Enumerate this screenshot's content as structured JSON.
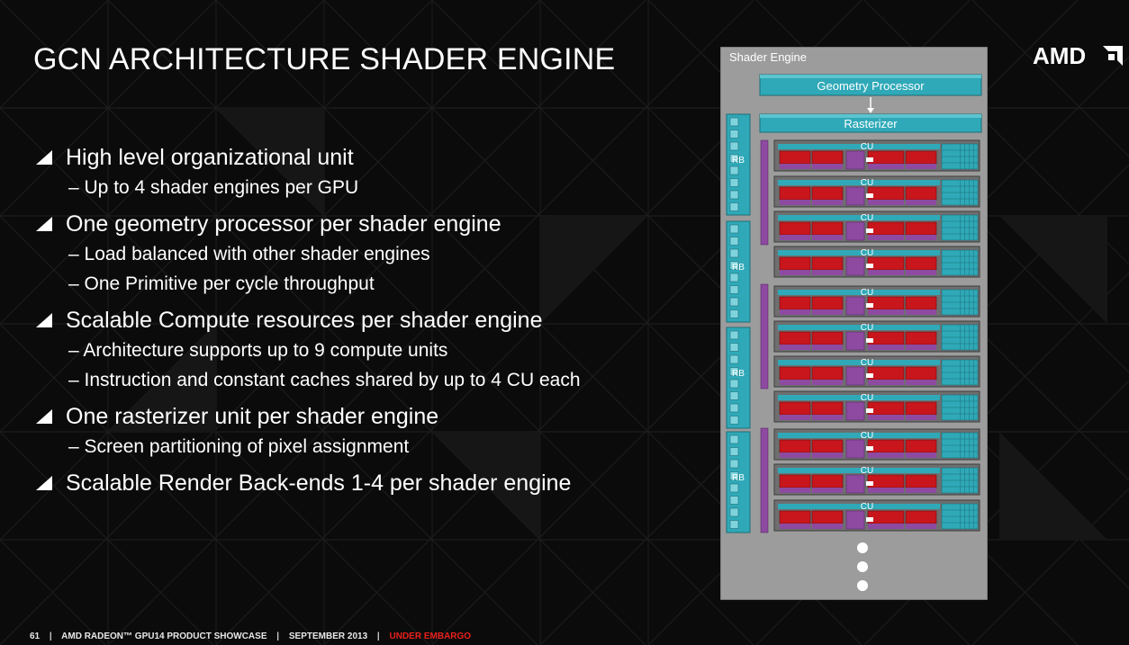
{
  "slide": {
    "title": "GCN ARCHITECTURE SHADER ENGINE",
    "logo_text": "AMD",
    "bullets": [
      {
        "text": "High level organizational unit",
        "subs": [
          "– Up to 4 shader engines per GPU"
        ]
      },
      {
        "text": "One geometry processor per shader engine",
        "subs": [
          "– Load balanced with other shader engines",
          "– One Primitive per cycle throughput"
        ]
      },
      {
        "text": "Scalable Compute resources per shader engine",
        "subs": [
          "– Architecture supports up to 9 compute units",
          "– Instruction and constant caches shared by up to 4 CU each"
        ]
      },
      {
        "text": "One rasterizer unit per shader engine",
        "subs": [
          "– Screen partitioning of pixel assignment"
        ]
      },
      {
        "text": "Scalable Render Back-ends 1-4 per shader engine",
        "subs": []
      }
    ]
  },
  "diagram": {
    "panel_label": "Shader Engine",
    "geometry_processor": "Geometry Processor",
    "rasterizer": "Rasterizer",
    "cu_label": "CU",
    "cu_count": 11,
    "rb_label": "RB",
    "rb_count": 4,
    "ellipsis_dots": 3
  },
  "footer": {
    "page_number": "61",
    "event": "AMD RADEON™ GPU14 PRODUCT SHOWCASE",
    "date": "SEPTEMBER 2013",
    "embargo": "UNDER EMBARGO",
    "separator": "|"
  },
  "colors": {
    "background": "#0b0b0b",
    "panel": "#9a9a9a",
    "teal": "#2fa9b8",
    "purple": "#8d4aa0",
    "red": "#c8161c",
    "embargo_red": "#e8201c",
    "text": "#ffffff"
  }
}
